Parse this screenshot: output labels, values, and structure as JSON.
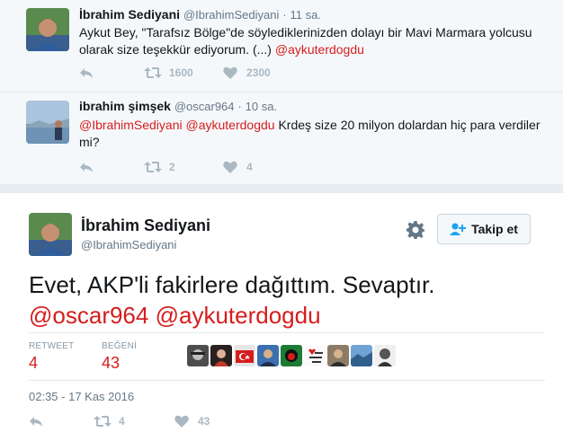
{
  "tweets": [
    {
      "fullname": "İbrahim Sediyani",
      "username": "@IbrahimSediyani",
      "dot": "·",
      "time": "11 sa.",
      "text_plain": "Aykut Bey, \"Tarafsız Bölge\"de söylediklerinizden dolayı bir Mavi Marmara yolcusu olarak size teşekkür ediyorum. (...) ",
      "text_mention": "@aykuterdogdu",
      "retweets": "1600",
      "likes": "2300"
    },
    {
      "fullname": "ibrahim şimşek",
      "username": "@oscar964",
      "dot": "·",
      "time": "10 sa.",
      "mention1": "@IbrahimSediyani",
      "mention2": "@aykuterdogdu",
      "text_plain": " Krdeş size 20 milyon dolardan hiç para verdiler mi?",
      "retweets": "2",
      "likes": "4"
    }
  ],
  "main_tweet": {
    "fullname": "İbrahim Sediyani",
    "username": "@IbrahimSediyani",
    "follow_label": "Takip et",
    "text_line1": "Evet, AKP'li fakirlere dağıttım. Sevaptır.",
    "mention1": "@oscar964",
    "mention2": "@aykuterdogdu",
    "retweet_label": "RETWEET",
    "retweet_count": "4",
    "like_label": "BEĞENİ",
    "like_count": "43",
    "timestamp": "02:35 - 17 Kas 2016",
    "action_retweets": "4",
    "action_likes": "43"
  },
  "colors": {
    "mention": "#d61d1d",
    "muted": "#657786",
    "icon": "#aab8c2",
    "feed_bg": "#f5f8fa"
  },
  "icons": [
    "reply-icon",
    "retweet-icon",
    "heart-icon",
    "gear-icon",
    "follow-person-icon"
  ]
}
